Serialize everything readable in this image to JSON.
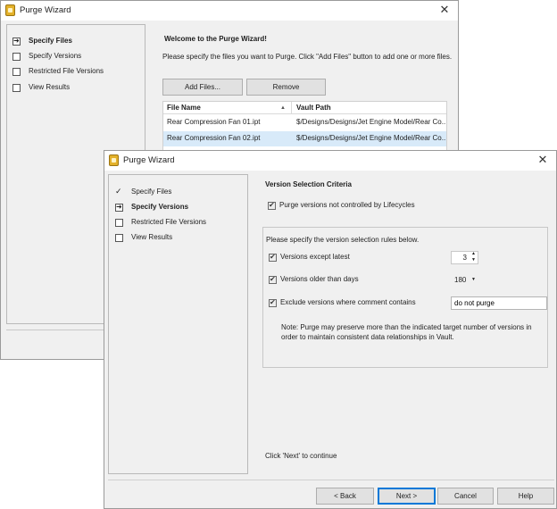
{
  "back_window": {
    "title": "Purge Wizard",
    "close_glyph": "✕",
    "steps": [
      {
        "label": "Specify Files",
        "state": "current"
      },
      {
        "label": "Specify Versions",
        "state": "pending"
      },
      {
        "label": "Restricted File Versions",
        "state": "pending"
      },
      {
        "label": "View Results",
        "state": "pending"
      }
    ],
    "heading": "Welcome to the Purge Wizard!",
    "instructions": "Please specify the files you want to Purge.  Click \"Add Files\" button to add one or more files.",
    "add_files_label": "Add Files...",
    "remove_label": "Remove",
    "grid": {
      "columns": [
        "File Name",
        "Vault Path"
      ],
      "sort_glyph": "▲",
      "rows": [
        {
          "file": "Rear Compression Fan 01.ipt",
          "path": "$/Designs/Designs/Jet Engine Model/Rear Co...",
          "selected": false
        },
        {
          "file": "Rear Compression Fan 02.ipt",
          "path": "$/Designs/Designs/Jet Engine Model/Rear Co...",
          "selected": true
        }
      ]
    }
  },
  "front_window": {
    "title": "Purge Wizard",
    "close_glyph": "✕",
    "steps": [
      {
        "label": "Specify Files",
        "state": "done"
      },
      {
        "label": "Specify Versions",
        "state": "current"
      },
      {
        "label": "Restricted File Versions",
        "state": "pending"
      },
      {
        "label": "View Results",
        "state": "pending"
      }
    ],
    "section_title": "Version Selection Criteria",
    "lifecycle_option": {
      "label": "Purge versions not controlled by Lifecycles",
      "checked": true
    },
    "rules_intro": "Please specify the version selection rules below.",
    "rules": {
      "latest": {
        "label": "Versions except latest",
        "checked": true,
        "value": "3"
      },
      "older": {
        "label": "Versions older than days",
        "checked": true,
        "value": "180"
      },
      "comment": {
        "label": "Exclude versions where comment contains",
        "checked": true,
        "value": "do not purge"
      }
    },
    "note_line1": "Note: Purge may preserve more than the indicated target number of versions in",
    "note_line2": "order to maintain consistent data relationships in Vault.",
    "continue_hint": "Click 'Next' to continue",
    "buttons": {
      "back": "< Back",
      "next": "Next >",
      "cancel": "Cancel",
      "help": "Help"
    }
  }
}
